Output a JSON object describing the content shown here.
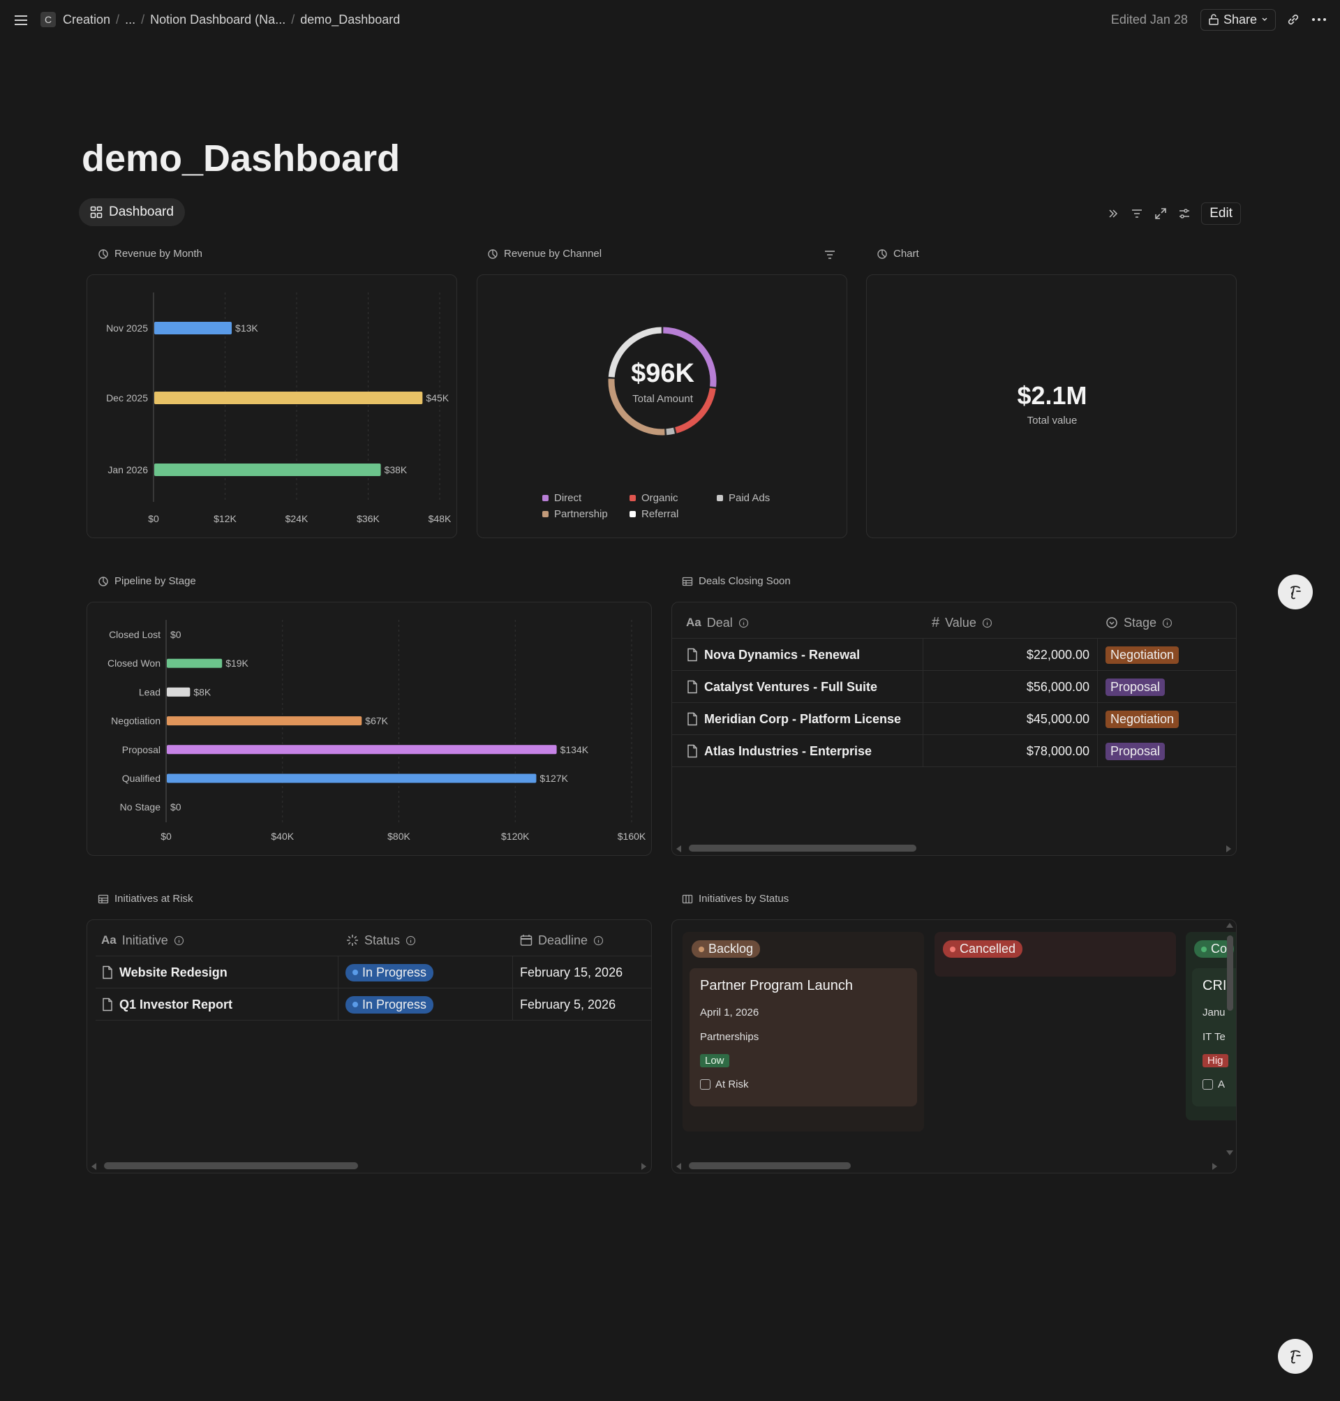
{
  "topbar": {
    "workspace_initial": "C",
    "breadcrumbs": [
      "Creation",
      "...",
      "Notion Dashboard (Na...",
      "demo_Dashboard"
    ],
    "edited": "Edited Jan 28",
    "share_label": "Share"
  },
  "page": {
    "title": "demo_Dashboard",
    "view_tab": "Dashboard",
    "edit_label": "Edit"
  },
  "revenue_by_month": {
    "label": "Revenue by Month",
    "chart_data": {
      "type": "bar",
      "orientation": "horizontal",
      "categories": [
        "Nov 2025",
        "Dec 2025",
        "Jan 2026"
      ],
      "values": [
        13000,
        45000,
        38000
      ],
      "value_labels": [
        "$13K",
        "$45K",
        "$38K"
      ],
      "colors": [
        "#5a9be8",
        "#e8c266",
        "#6cc48c"
      ],
      "xticks": [
        "$0",
        "$12K",
        "$24K",
        "$36K",
        "$48K"
      ],
      "xlim": [
        0,
        48000
      ],
      "grid": true
    }
  },
  "revenue_by_channel": {
    "label": "Revenue by Channel",
    "total": "$96K",
    "total_label": "Total Amount",
    "chart_data": {
      "type": "pie",
      "donut": true,
      "legend": [
        "Direct",
        "Organic",
        "Paid Ads",
        "Partnership",
        "Referral"
      ],
      "legend_colors": [
        "#b87fd6",
        "#e0564f",
        "#c9c9c9",
        "#c29a7a",
        "#ffffff"
      ],
      "segments": [
        {
          "name": "Direct",
          "value": 27,
          "color": "#b87fd6"
        },
        {
          "name": "Organic",
          "value": 19,
          "color": "#e0564f"
        },
        {
          "name": "Paid Ads",
          "value": 3,
          "color": "#b9b9b9"
        },
        {
          "name": "Partnership",
          "value": 27,
          "color": "#c29a7a"
        },
        {
          "name": "Referral",
          "value": 24,
          "color": "#e0e0e0"
        }
      ]
    }
  },
  "chart_number": {
    "label": "Chart",
    "value": "$2.1M",
    "caption": "Total value"
  },
  "pipeline_by_stage": {
    "label": "Pipeline by Stage",
    "chart_data": {
      "type": "bar",
      "orientation": "horizontal",
      "categories": [
        "Closed Lost",
        "Closed Won",
        "Lead",
        "Negotiation",
        "Proposal",
        "Qualified",
        "No Stage"
      ],
      "values": [
        0,
        19000,
        8000,
        67000,
        134000,
        127000,
        0
      ],
      "value_labels": [
        "$0",
        "$19K",
        "$8K",
        "$67K",
        "$134K",
        "$127K",
        "$0"
      ],
      "colors": [
        "#6cc48c",
        "#6cc48c",
        "#d9d9d9",
        "#e0955a",
        "#c683e6",
        "#5a9be8",
        "#6cc48c"
      ],
      "xticks": [
        "$0",
        "$40K",
        "$80K",
        "$120K",
        "$160K"
      ],
      "xlim": [
        0,
        160000
      ],
      "grid": true
    }
  },
  "deals_closing_soon": {
    "label": "Deals Closing Soon",
    "columns": [
      "Deal",
      "Value",
      "Stage"
    ],
    "rows": [
      {
        "deal": "Nova Dynamics - Renewal",
        "value": "$22,000.00",
        "stage": "Negotiation",
        "stage_color": "#8a4a23"
      },
      {
        "deal": "Catalyst Ventures - Full Suite",
        "value": "$56,000.00",
        "stage": "Proposal",
        "stage_color": "#5b3f7a"
      },
      {
        "deal": "Meridian Corp - Platform License",
        "value": "$45,000.00",
        "stage": "Negotiation",
        "stage_color": "#8a4a23"
      },
      {
        "deal": "Atlas Industries - Enterprise",
        "value": "$78,000.00",
        "stage": "Proposal",
        "stage_color": "#5b3f7a"
      }
    ]
  },
  "initiatives_at_risk": {
    "label": "Initiatives at Risk",
    "columns": [
      "Initiative",
      "Status",
      "Deadline"
    ],
    "rows": [
      {
        "initiative": "Website Redesign",
        "status": "In Progress",
        "deadline": "February 15, 2026"
      },
      {
        "initiative": "Q1 Investor Report",
        "status": "In Progress",
        "deadline": "February 5, 2026"
      }
    ]
  },
  "initiatives_by_status": {
    "label": "Initiatives by Status",
    "groups": [
      {
        "name": "Backlog",
        "color": "#7a5a46",
        "dot": "#c8946a"
      },
      {
        "name": "Cancelled",
        "color": "#a33b36",
        "dot": "#e0564f"
      },
      {
        "name": "Co",
        "color": "#2f6b45",
        "dot": "#4caf6e"
      }
    ],
    "card": {
      "title": "Partner Program Launch",
      "date": "April 1, 2026",
      "team": "Partnerships",
      "priority": "Low",
      "checkbox_label": "At Risk"
    },
    "card2": {
      "title": "CRI",
      "date": "Janu",
      "team": "IT Te",
      "priority": "Hig",
      "checkbox_label": "A"
    }
  }
}
